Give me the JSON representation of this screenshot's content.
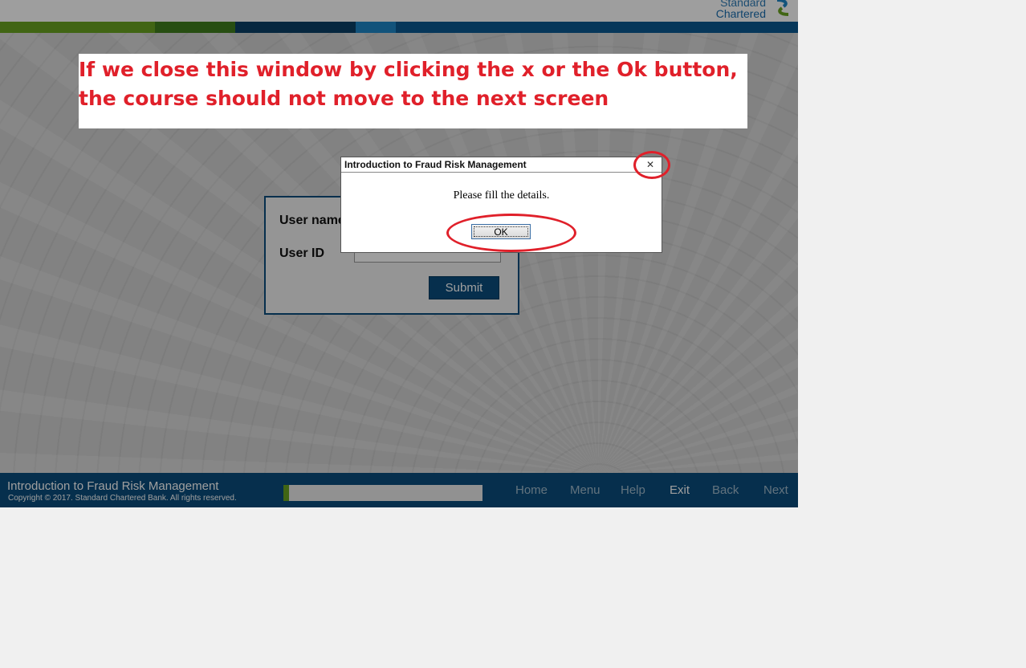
{
  "brand": {
    "line1": "Standard",
    "line2": "Chartered"
  },
  "colors": {
    "green": "#6aa321",
    "dark_green": "#3f7f1e",
    "navy": "#0b4d7c",
    "light_blue": "#1d87c7",
    "annotation_red": "#e0202a"
  },
  "login": {
    "username_label": "User name",
    "userid_label": "User ID",
    "submit_label": "Submit"
  },
  "footer": {
    "course_title": "Introduction to Fraud Risk Management",
    "copyright": "Copyright © 2017. Standard Chartered Bank. All rights reserved.",
    "progress_percent": 3,
    "nav": [
      "Home",
      "Menu",
      "Help",
      "Exit",
      "Back",
      "Next"
    ]
  },
  "dialog": {
    "title": "Introduction to Fraud Risk Management",
    "close_glyph": "✕",
    "message": "Please fill the details.",
    "ok_label": "OK"
  },
  "annotation": {
    "text": "If we close this window by clicking the x or the Ok button, the course should not move to the next screen"
  }
}
